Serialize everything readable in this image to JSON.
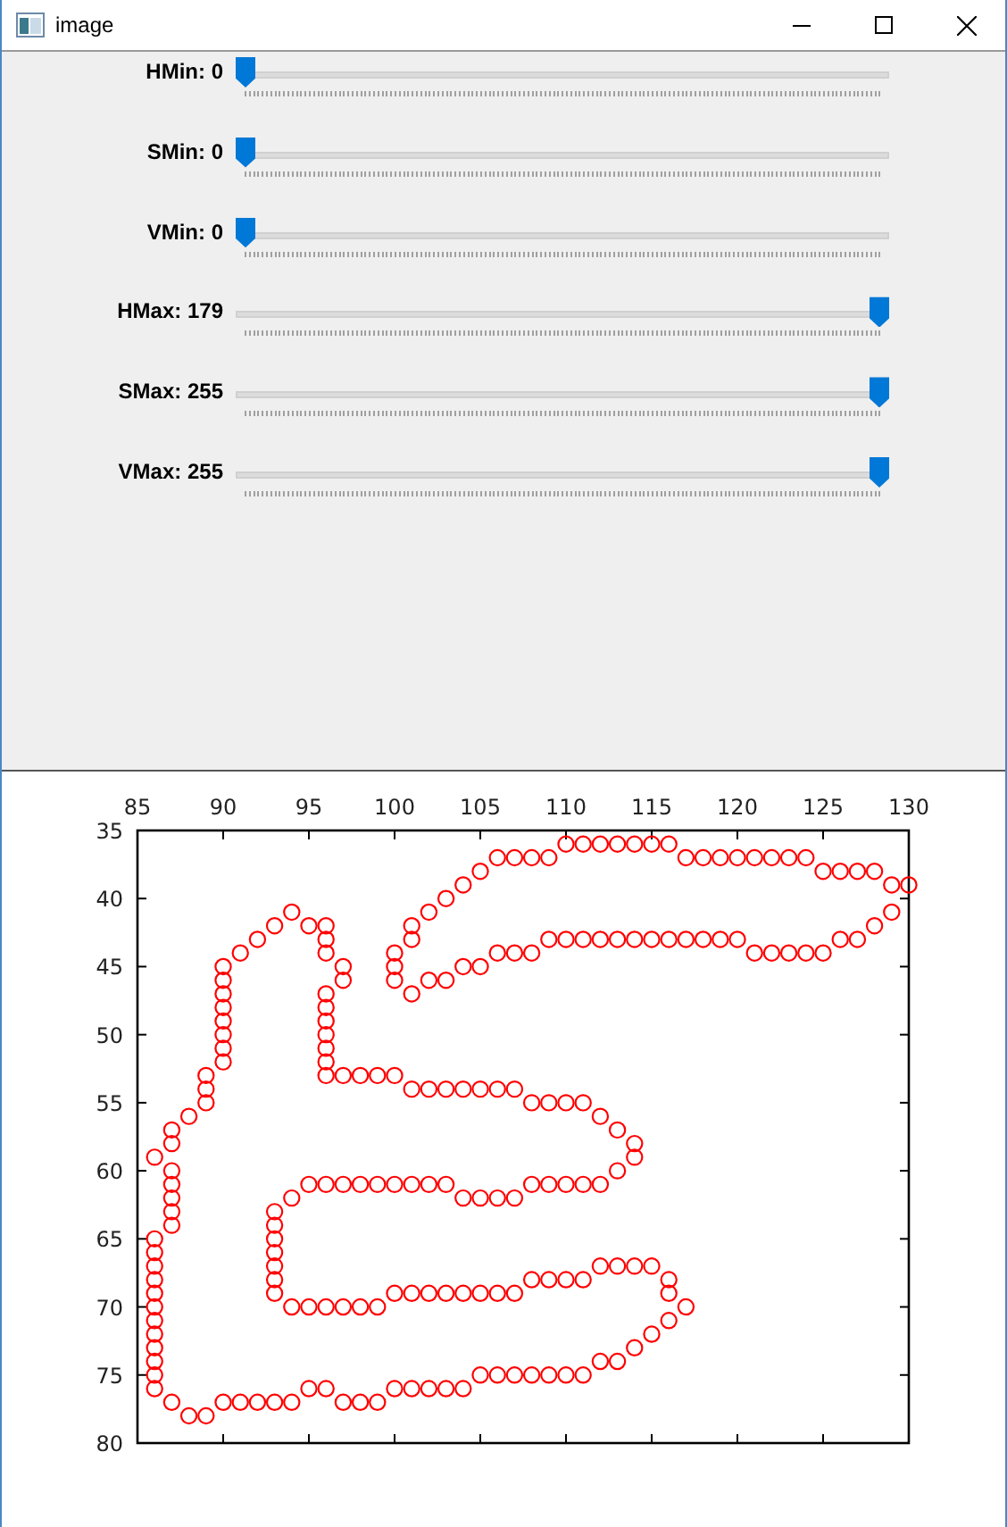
{
  "window": {
    "title": "image"
  },
  "trackbars": [
    {
      "label": "HMin: 0",
      "level": 0
    },
    {
      "label": "SMin: 0",
      "level": 0
    },
    {
      "label": "VMin: 0",
      "level": 0
    },
    {
      "label": "HMax: 179",
      "level": 1
    },
    {
      "label": "SMax: 255",
      "level": 1
    },
    {
      "label": "VMax: 255",
      "level": 1
    }
  ],
  "plot": {
    "chart_data": {
      "type": "scatter",
      "xlim": [
        85,
        130
      ],
      "ylim": [
        80,
        35
      ],
      "xticks": [
        85,
        90,
        95,
        100,
        105,
        110,
        115,
        120,
        125,
        130
      ],
      "yticks": [
        35,
        40,
        45,
        50,
        55,
        60,
        65,
        70,
        75,
        80
      ],
      "x": [
        110,
        111,
        112,
        113,
        114,
        115,
        116,
        106,
        107,
        108,
        109,
        117,
        118,
        119,
        120,
        121,
        122,
        123,
        124,
        105,
        125,
        126,
        127,
        128,
        104,
        129,
        130,
        103,
        94,
        102,
        129,
        93,
        95,
        96,
        101,
        128,
        92,
        96,
        101,
        109,
        110,
        111,
        112,
        113,
        114,
        115,
        116,
        117,
        118,
        119,
        120,
        126,
        127,
        91,
        96,
        100,
        106,
        107,
        108,
        121,
        122,
        123,
        124,
        125,
        90,
        97,
        100,
        104,
        105,
        90,
        97,
        100,
        102,
        103,
        90,
        96,
        101,
        90,
        96,
        90,
        96,
        90,
        96,
        90,
        96,
        90,
        96,
        89,
        96,
        97,
        98,
        99,
        100,
        89,
        101,
        102,
        103,
        104,
        105,
        106,
        107,
        89,
        108,
        109,
        110,
        111,
        88,
        112,
        87,
        113,
        87,
        114,
        86,
        114,
        87,
        113,
        87,
        95,
        96,
        97,
        98,
        99,
        100,
        101,
        102,
        103,
        108,
        109,
        110,
        111,
        112,
        87,
        94,
        104,
        105,
        106,
        107,
        87,
        93,
        87,
        93,
        86,
        93,
        86,
        93,
        86,
        93,
        112,
        113,
        114,
        115,
        86,
        93,
        108,
        109,
        110,
        111,
        116,
        86,
        93,
        100,
        101,
        102,
        103,
        104,
        105,
        106,
        107,
        116,
        86,
        94,
        95,
        96,
        97,
        98,
        99,
        117,
        86,
        116,
        86,
        115,
        86,
        114,
        86,
        112,
        113,
        86,
        105,
        106,
        107,
        108,
        109,
        110,
        111,
        86,
        95,
        96,
        100,
        101,
        102,
        103,
        104,
        87,
        90,
        91,
        92,
        93,
        94,
        97,
        98,
        99,
        88,
        89
      ],
      "series": [
        {
          "color": "#ff0000",
          "values": [
            36,
            36,
            36,
            36,
            36,
            36,
            36,
            37,
            37,
            37,
            37,
            37,
            37,
            37,
            37,
            37,
            37,
            37,
            37,
            38,
            38,
            38,
            38,
            38,
            39,
            39,
            39,
            40,
            41,
            41,
            41,
            42,
            42,
            42,
            42,
            42,
            43,
            43,
            43,
            43,
            43,
            43,
            43,
            43,
            43,
            43,
            43,
            43,
            43,
            43,
            43,
            43,
            43,
            44,
            44,
            44,
            44,
            44,
            44,
            44,
            44,
            44,
            44,
            44,
            45,
            45,
            45,
            45,
            45,
            46,
            46,
            46,
            46,
            46,
            47,
            47,
            47,
            48,
            48,
            49,
            49,
            50,
            50,
            51,
            51,
            52,
            52,
            53,
            53,
            53,
            53,
            53,
            53,
            54,
            54,
            54,
            54,
            54,
            54,
            54,
            54,
            55,
            55,
            55,
            55,
            55,
            56,
            56,
            57,
            57,
            58,
            58,
            59,
            59,
            60,
            60,
            61,
            61,
            61,
            61,
            61,
            61,
            61,
            61,
            61,
            61,
            61,
            61,
            61,
            61,
            61,
            62,
            62,
            62,
            62,
            62,
            62,
            63,
            63,
            64,
            64,
            65,
            65,
            66,
            66,
            67,
            67,
            67,
            67,
            67,
            67,
            68,
            68,
            68,
            68,
            68,
            68,
            68,
            69,
            69,
            69,
            69,
            69,
            69,
            69,
            69,
            69,
            69,
            69,
            70,
            70,
            70,
            70,
            70,
            70,
            70,
            70,
            71,
            71,
            72,
            72,
            73,
            73,
            74,
            74,
            74,
            75,
            75,
            75,
            75,
            75,
            75,
            75,
            75,
            76,
            76,
            76,
            76,
            76,
            76,
            76,
            76,
            77,
            77,
            77,
            77,
            77,
            77,
            77,
            77,
            77,
            78,
            78
          ]
        }
      ]
    }
  }
}
